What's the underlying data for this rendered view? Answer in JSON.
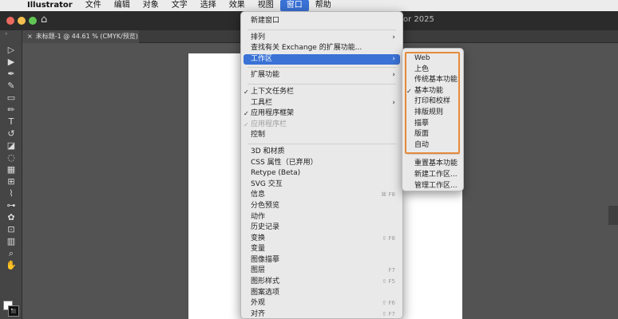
{
  "menubar": {
    "apple_icon": "",
    "app_name": "Illustrator",
    "items": [
      "文件",
      "编辑",
      "对象",
      "文字",
      "选择",
      "效果",
      "视图",
      "窗口",
      "帮助"
    ],
    "active_item": "窗口"
  },
  "appbar": {
    "title": "or 2025",
    "home_icon": "home-icon"
  },
  "document_tab": {
    "close": "×",
    "label": "未标题-1 @ 44.61 % (CMYK/预览)"
  },
  "tools_panel": {
    "grip": "»"
  },
  "window_menu": {
    "items": [
      {
        "label": "新建窗口"
      },
      {
        "separator": true
      },
      {
        "label": "排列",
        "submenu": true
      },
      {
        "label": "查找有关 Exchange 的扩展功能..."
      },
      {
        "label": "工作区",
        "submenu": true,
        "highlighted": true
      },
      {
        "separator": true
      },
      {
        "label": "扩展功能",
        "submenu": true
      },
      {
        "separator": true
      },
      {
        "label": "上下文任务栏",
        "checked": true
      },
      {
        "label": "工具栏",
        "submenu": true
      },
      {
        "label": "应用程序框架",
        "checked": true
      },
      {
        "label": "应用程序栏",
        "checked": true,
        "disabled": true
      },
      {
        "label": "控制"
      },
      {
        "separator": true
      },
      {
        "label": "3D 和材质"
      },
      {
        "label": "CSS 属性（已弃用）"
      },
      {
        "label": "Retype (Beta)"
      },
      {
        "label": "SVG 交互"
      },
      {
        "label": "信息",
        "shortcut": "⌘ F8"
      },
      {
        "label": "分色预览"
      },
      {
        "label": "动作"
      },
      {
        "label": "历史记录"
      },
      {
        "label": "变换",
        "shortcut": "⇧ F8"
      },
      {
        "label": "变量"
      },
      {
        "label": "图像描摹"
      },
      {
        "label": "图层",
        "shortcut": "F7"
      },
      {
        "label": "图形样式",
        "shortcut": "⇧ F5"
      },
      {
        "label": "图案选项"
      },
      {
        "label": "外观",
        "shortcut": "⇧ F6"
      },
      {
        "label": "对齐",
        "shortcut": "⇧ F7"
      }
    ]
  },
  "workspace_submenu": {
    "items": [
      {
        "label": "Web"
      },
      {
        "label": "上色"
      },
      {
        "label": "传统基本功能"
      },
      {
        "label": "基本功能",
        "checked": true
      },
      {
        "label": "打印和校样"
      },
      {
        "label": "排版规则"
      },
      {
        "label": "描摹"
      },
      {
        "label": "版面"
      },
      {
        "label": "自动"
      }
    ],
    "actions": [
      {
        "label": "重置基本功能"
      },
      {
        "label": "新建工作区..."
      },
      {
        "label": "管理工作区..."
      }
    ]
  },
  "colors": {
    "highlight": "#3a72d6",
    "annotation_outline": "#e58a3a"
  }
}
